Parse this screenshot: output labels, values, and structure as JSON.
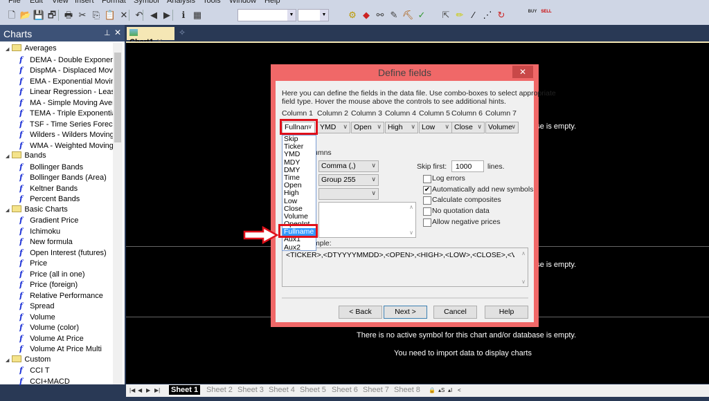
{
  "menu": [
    "File",
    "Edit",
    "View",
    "Insert",
    "Format",
    "Symbol",
    "Analysis",
    "Tools",
    "Window",
    "Help"
  ],
  "toolbar": {
    "icons": [
      "new-icon",
      "open-icon",
      "save-icon",
      "save-all-icon",
      "print-icon",
      "cut-icon",
      "copy-icon",
      "paste-icon",
      "delete-icon",
      "undo-icon",
      "back-icon",
      "forward-icon",
      "info-icon",
      "properties-icon"
    ],
    "buy_label": "BUY",
    "sell_label": "SELL"
  },
  "panel": {
    "title": "Charts",
    "groups": [
      {
        "label": "Averages",
        "items": [
          "DEMA - Double Exponential",
          "DispMA - Displaced Moving",
          "EMA - Exponential Moving",
          "Linear Regression - Least S",
          "MA - Simple Moving Aver",
          "TEMA - Triple Exponential",
          "TSF - Time Series Forecast",
          "Wilders - Wilders Moving",
          "WMA - Weighted Moving"
        ]
      },
      {
        "label": "Bands",
        "items": [
          "Bollinger Bands",
          "Bollinger Bands (Area)",
          "Keltner Bands",
          "Percent Bands"
        ]
      },
      {
        "label": "Basic Charts",
        "items": [
          "Gradient Price",
          "Ichimoku",
          "New formula",
          "Open Interest (futures)",
          "Price",
          "Price (all in one)",
          "Price (foreign)",
          "Relative Performance",
          "Spread",
          "Volume",
          "Volume (color)",
          "Volume At Price",
          "Volume At Price Multi"
        ]
      },
      {
        "label": "Custom",
        "items": [
          "CCI T",
          "CCI+MACD"
        ]
      }
    ]
  },
  "tab": {
    "label": "Chart1"
  },
  "chart": {
    "empty_msg": "There is no active symbol for this chart and/or database is empty.",
    "import_msg": "You need to import data to display charts"
  },
  "sheets": [
    "Sheet 1",
    "Sheet 2",
    "Sheet 3",
    "Sheet 4",
    "Sheet 5",
    "Sheet 6",
    "Sheet 7",
    "Sheet 8"
  ],
  "dialog": {
    "title": "Define fields",
    "intro1": "Here you can define the fields in the data file. Use combo-boxes to select appropriate",
    "intro2": "field type. Hover the mouse above the controls to see additional hints.",
    "columns": [
      {
        "label": "Column 1",
        "value": "Fullnan"
      },
      {
        "label": "Column 2",
        "value": "YMD"
      },
      {
        "label": "Column 3",
        "value": "Open"
      },
      {
        "label": "Column 4",
        "value": "High"
      },
      {
        "label": "Column 5",
        "value": "Low"
      },
      {
        "label": "Column 6",
        "value": "Close"
      },
      {
        "label": "Column 7",
        "value": "Volume"
      }
    ],
    "dropdown_options": [
      "Skip",
      "Ticker",
      "YMD",
      "MDY",
      "DMY",
      "Time",
      "Open",
      "High",
      "Low",
      "Close",
      "Volume",
      "OpenInt",
      "Fullname",
      "Aux1",
      "Aux2"
    ],
    "dropdown_selected": "Fullname",
    "columns_fragment": "umns",
    "separator_value": "Comma (,)",
    "group_value": "Group 255",
    "third_value": "",
    "skip_first_label": "Skip first:",
    "skip_first_value": "1000",
    "lines_label": "lines.",
    "checkboxes": [
      {
        "label": "Log errors",
        "checked": false
      },
      {
        "label": "Automatically add new symbols",
        "checked": true
      },
      {
        "label": "Calculate composites",
        "checked": false
      },
      {
        "label": "No quotation data",
        "checked": false
      },
      {
        "label": "Allow negative prices",
        "checked": false
      }
    ],
    "sample_fragment": "mple:",
    "sample_text": "<TICKER>,<DTYYYYMMDD>,<OPEN>,<HIGH>,<LOW>,<CLOSE>,<VOL>,<O",
    "buttons": {
      "back": "< Back",
      "next": "Next >",
      "cancel": "Cancel",
      "help": "Help"
    },
    "close": "✕"
  },
  "colors": {
    "highlight_box": "#e0101a",
    "dialog_frame": "#f06868",
    "selection": "#3399ff"
  }
}
